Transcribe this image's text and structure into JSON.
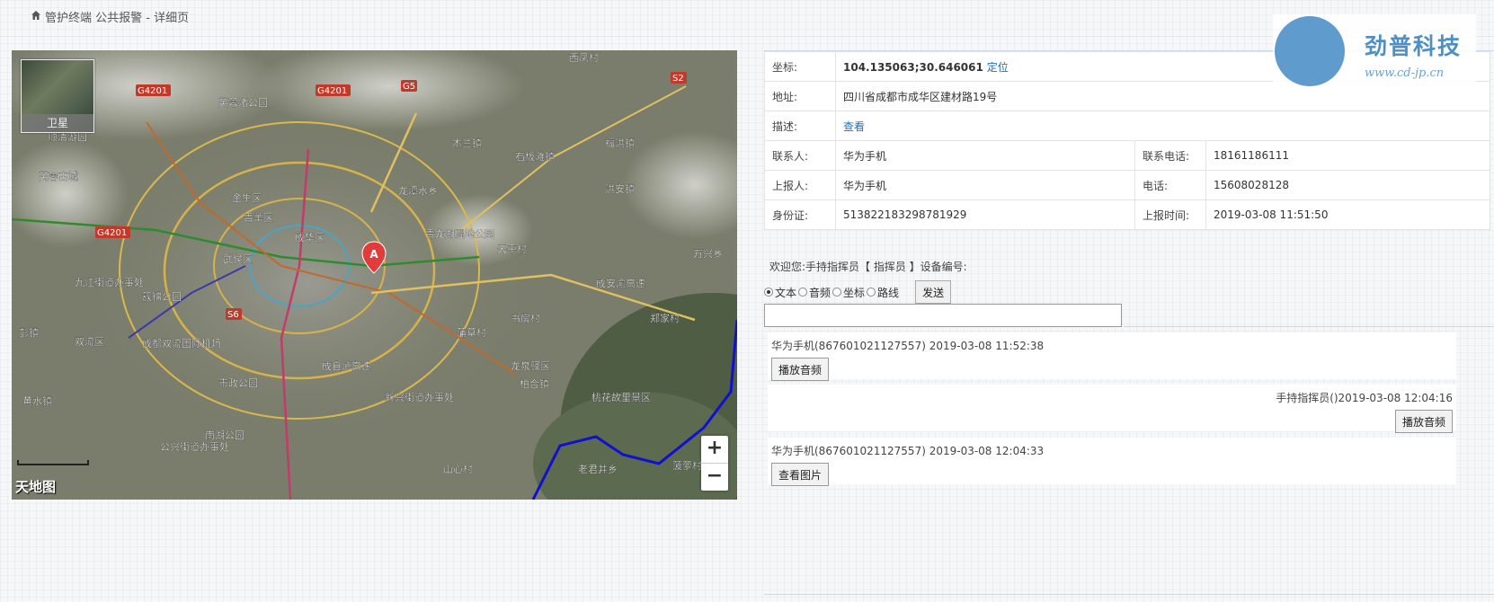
{
  "breadcrumb": {
    "text": "管护终端 公共报警 - 详细页",
    "icon": "home-icon"
  },
  "map": {
    "layer_label": "卫星",
    "marker_label": "A",
    "logo": "天地图",
    "zoom_in": "+",
    "zoom_out": "−",
    "labels": [
      "西凤村",
      "芙蓉渚公园",
      "顺清游园",
      "芙蓉古城",
      "金牛区",
      "青羊区",
      "成华区",
      "武侯区",
      "龙潭水乡",
      "木兰镇",
      "石板滩镇",
      "福洪镇",
      "洪安镇",
      "青龙湖湿地公园",
      "天平村",
      "万兴乡",
      "九江街道办事处",
      "簇锦公园",
      "成都双流国际机场",
      "双流区",
      "彭镇",
      "市政公园",
      "黄水镇",
      "南湖公园",
      "公兴街道办事处",
      "成自泸高速",
      "新兴街道办事处",
      "蒲草村",
      "书房村",
      "龙泉驿区",
      "柏合镇",
      "桃花故里景区",
      "郑家村",
      "成安渝高速",
      "菠萝村",
      "山心村",
      "老君井乡"
    ],
    "roads": [
      "G4201",
      "G4201",
      "G4201",
      "G5",
      "S2",
      "S6"
    ]
  },
  "info": {
    "coord_label": "坐标:",
    "coord_value": "104.135063;30.646061",
    "locate_link": "定位",
    "addr_label": "地址:",
    "addr_value": "四川省成都市成华区建材路19号",
    "desc_label": "描述:",
    "desc_link": "查看",
    "contact_label": "联系人:",
    "contact_value": "华为手机",
    "contact_phone_label": "联系电话:",
    "contact_phone_value": "18161186111",
    "reporter_label": "上报人:",
    "reporter_value": "华为手机",
    "phone_label": "电话:",
    "phone_value": "15608028128",
    "id_label": "身份证:",
    "id_value": "513822183298781929",
    "time_label": "上报时间:",
    "time_value": "2019-03-08 11:51:50"
  },
  "welcome": "欢迎您:手持指挥员【 指挥员 】设备编号:",
  "send_options": [
    {
      "label": "文本",
      "selected": true
    },
    {
      "label": "音频",
      "selected": false
    },
    {
      "label": "坐标",
      "selected": false
    },
    {
      "label": "路线",
      "selected": false
    }
  ],
  "send_button": "发送",
  "message_input": {
    "value": "",
    "placeholder": ""
  },
  "messages": [
    {
      "meta": "华为手机(867601021127557) 2019-03-08 11:52:38",
      "button": "播放音频",
      "align": "left"
    },
    {
      "meta": "手持指挥员()2019-03-08 12:04:16",
      "button": "播放音频",
      "align": "right"
    },
    {
      "meta": "华为手机(867601021127557) 2019-03-08 12:04:33",
      "button": "查看图片",
      "align": "left"
    }
  ],
  "brand": {
    "name": "劲普科技",
    "url": "www.cd-jp.cn"
  }
}
